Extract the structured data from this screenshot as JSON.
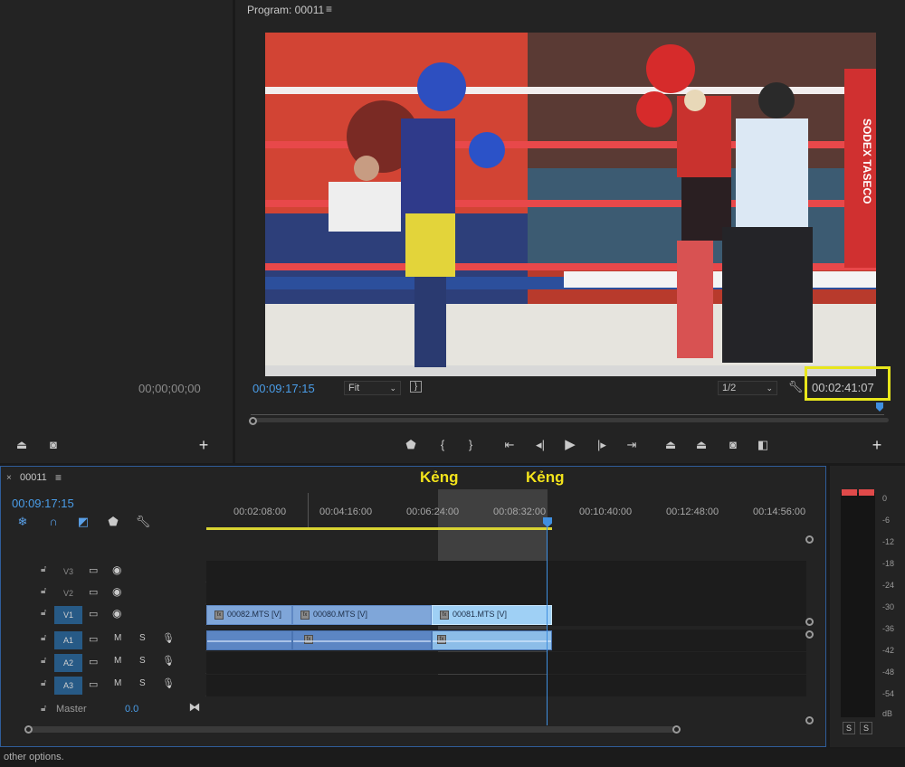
{
  "source": {
    "timecode": "00;00;00;00"
  },
  "program": {
    "title": "Program: 00011",
    "menu_icon": "≡",
    "current_timecode": "00:09:17:15",
    "fit_label": "Fit",
    "resolution_label": "1/2",
    "duration": "00:02:41:07",
    "video_banner": "SODEX TASECO"
  },
  "timeline": {
    "sequence_name": "00011",
    "close_icon": "×",
    "menu_icon": "≡",
    "timecode": "00:09:17:15",
    "ruler": [
      "00:02:08:00",
      "00:04:16:00",
      "00:06:24:00",
      "00:08:32:00",
      "00:10:40:00",
      "00:12:48:00",
      "00:14:56:00"
    ],
    "markers": [
      "Kẻng",
      "Kẻng"
    ],
    "tracks": {
      "v3": "V3",
      "v2": "V2",
      "v1_target": "V1",
      "a1": "A1",
      "a2": "A2",
      "a3": "A3",
      "m": "M",
      "s": "S",
      "master": "Master",
      "master_value": "0.0"
    },
    "clips": [
      "00082.MTS [V]",
      "00080.MTS [V]",
      "00081.MTS [V]"
    ],
    "fx": "fx"
  },
  "meter": {
    "scale": [
      "0",
      "-6",
      "-12",
      "-18",
      "-24",
      "-30",
      "-36",
      "-42",
      "-48",
      "-54",
      "dB"
    ],
    "solo_left": "S",
    "solo_right": "S",
    "peak_color": "#e04a4a"
  },
  "status": {
    "text": "other options."
  },
  "colors": {
    "accent": "#3f8fe0",
    "highlight_box": "#e8e61c",
    "marker_text": "#f3e31b",
    "work_area": "#d8d332"
  },
  "icons": {
    "program_toolbar": [
      "export-frame-icon",
      "wrench-icon",
      "add-marker-icon",
      "mark-in-icon",
      "mark-out-icon",
      "go-to-in-icon",
      "step-back-icon",
      "play-icon",
      "step-forward-icon",
      "go-to-out-icon",
      "lift-icon",
      "extract-icon",
      "camera-icon",
      "compare-icon",
      "plus-icon"
    ],
    "timeline_tools": [
      "snap-icon",
      "magnet-icon",
      "linked-selection-icon",
      "marker-icon",
      "wrench-icon"
    ]
  }
}
